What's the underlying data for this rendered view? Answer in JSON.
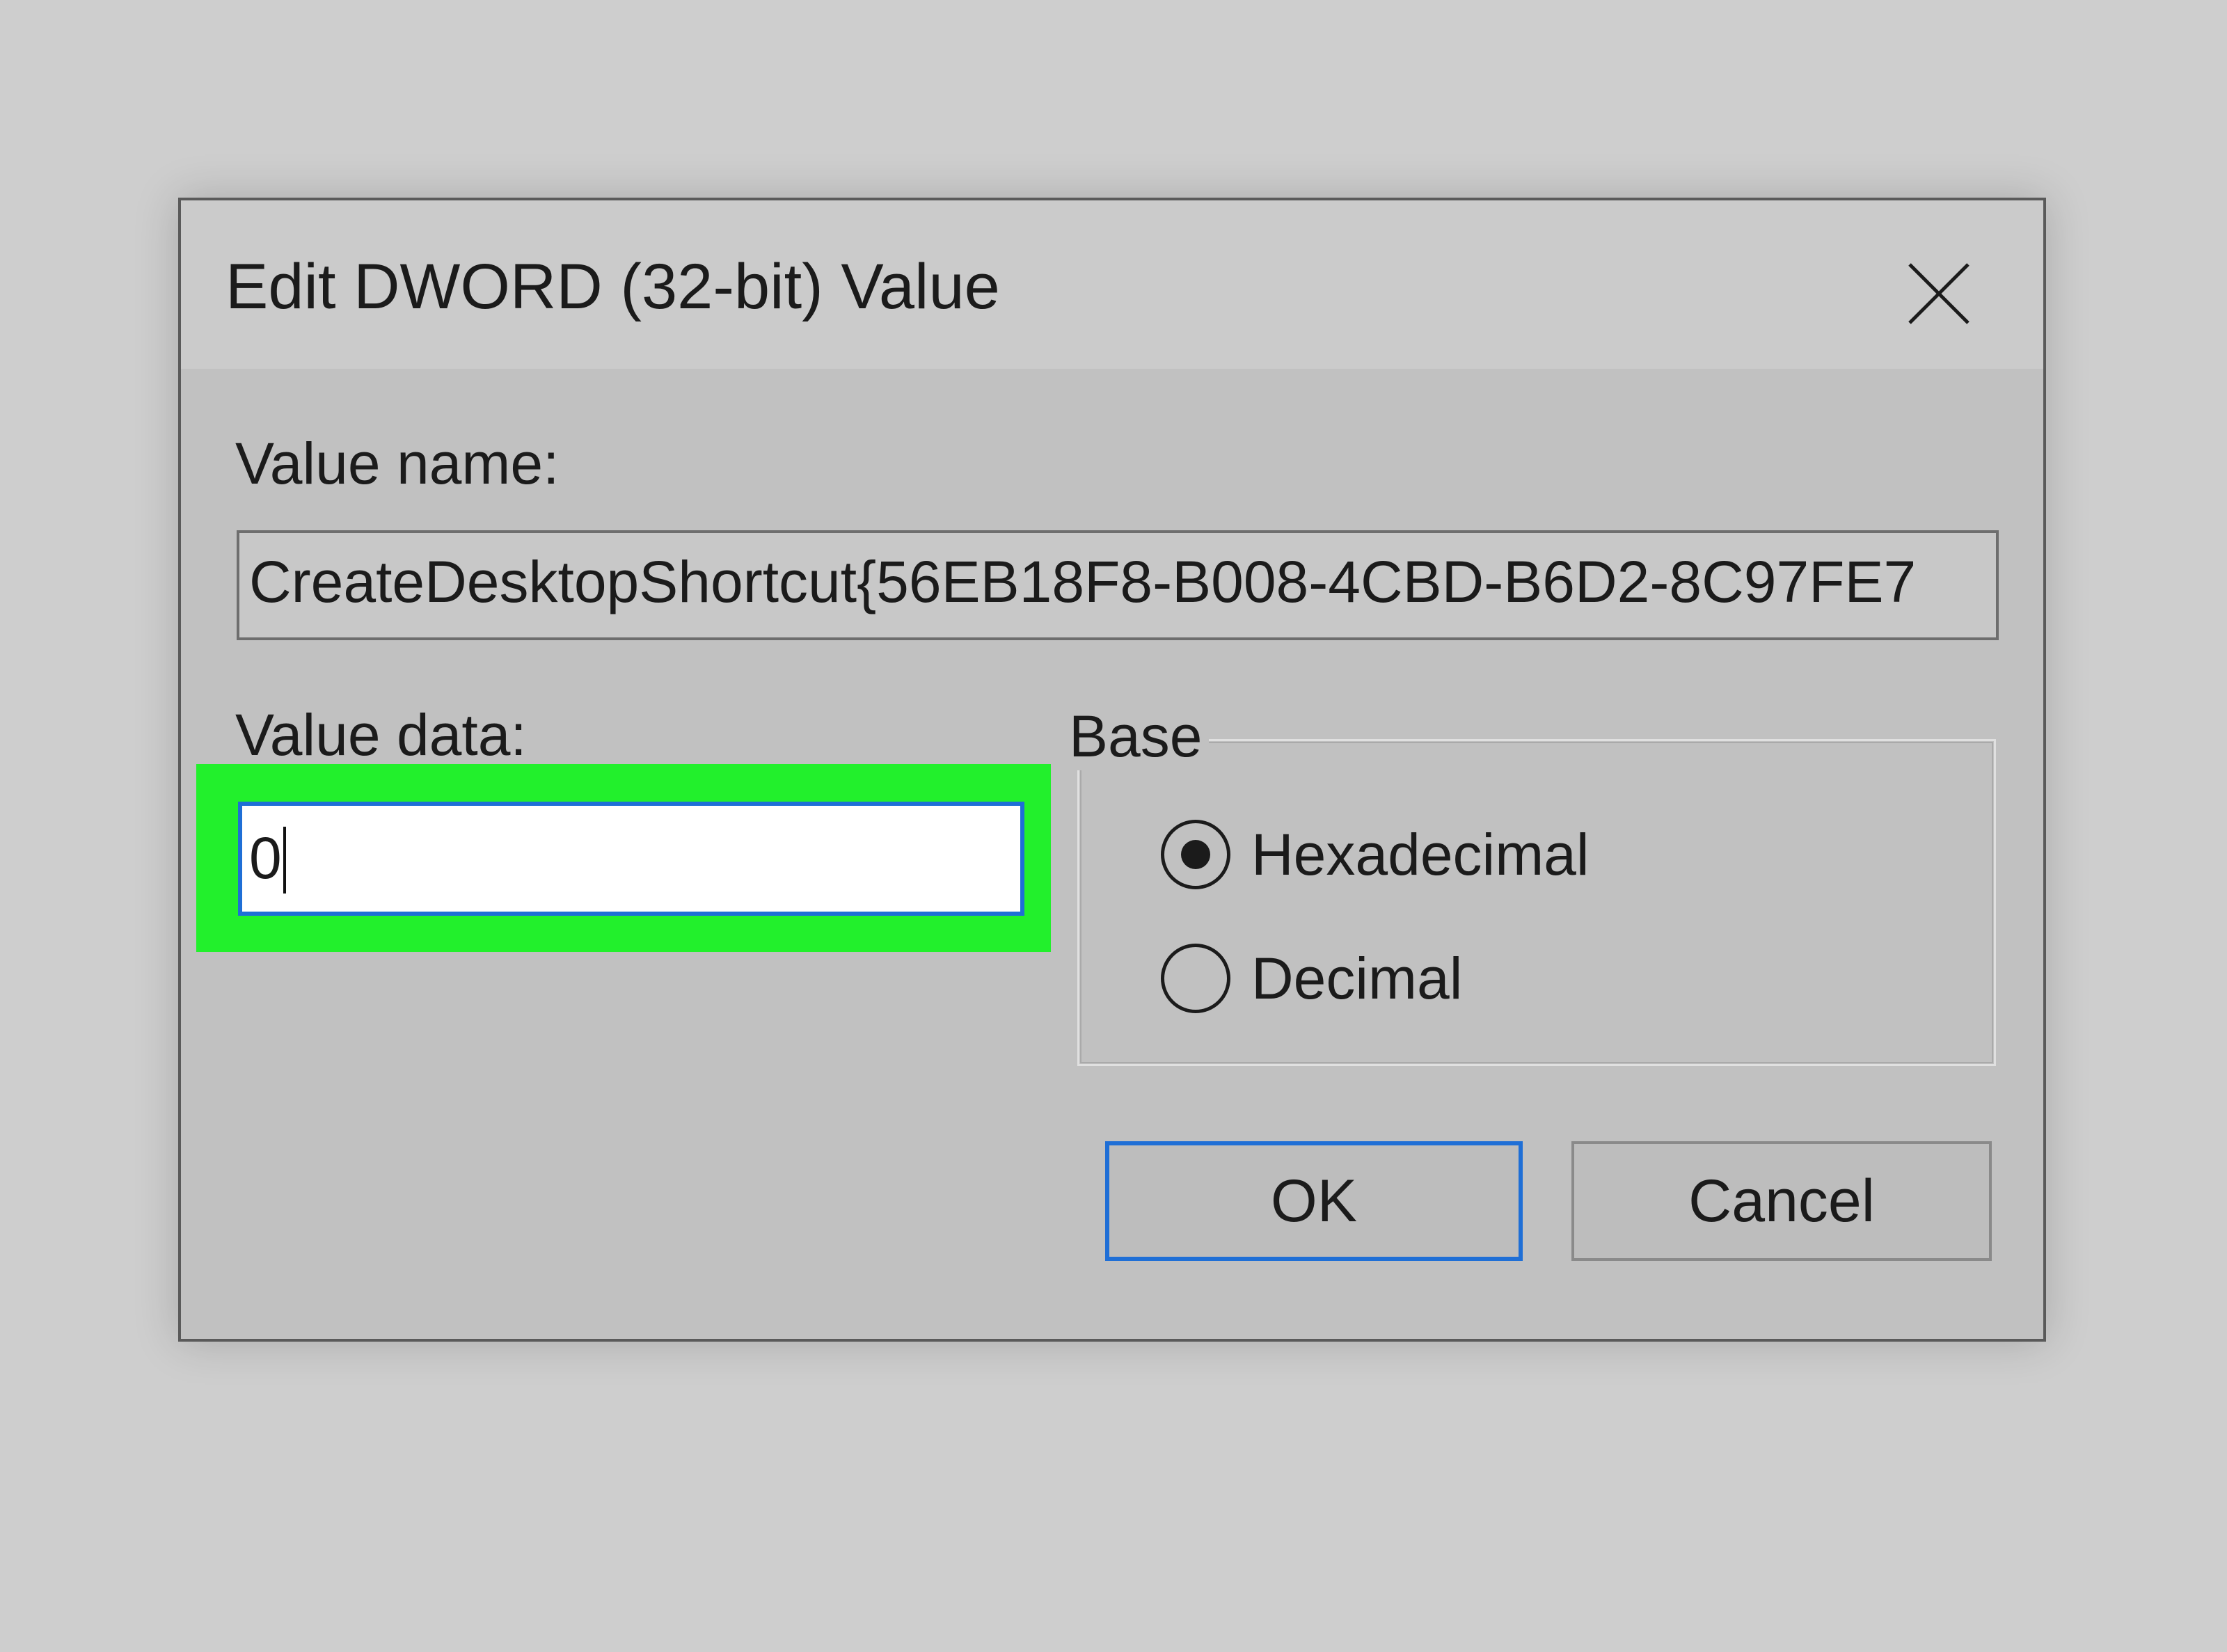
{
  "dialog": {
    "title": "Edit DWORD (32-bit) Value",
    "value_name_label": "Value name:",
    "value_name": "CreateDesktopShortcut{56EB18F8-B008-4CBD-B6D2-8C97FE7",
    "value_data_label": "Value data:",
    "value_data": "0",
    "base": {
      "legend": "Base",
      "options": [
        {
          "label": "Hexadecimal",
          "checked": true
        },
        {
          "label": "Decimal",
          "checked": false
        }
      ]
    },
    "buttons": {
      "ok": "OK",
      "cancel": "Cancel"
    }
  },
  "colors": {
    "highlight": "#22f02c",
    "focus_border": "#1f6fd6",
    "background": "#cecece",
    "dialog_body": "#c1c1c1"
  },
  "icons": {
    "close": "close-icon"
  }
}
